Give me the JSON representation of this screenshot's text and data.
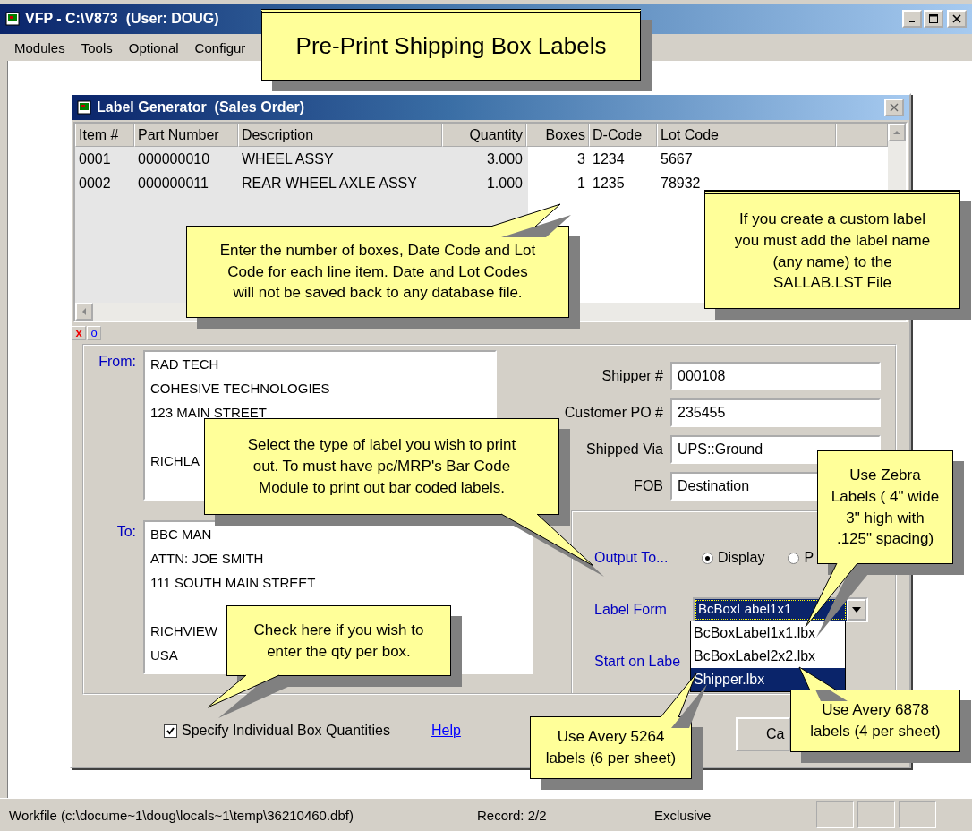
{
  "window": {
    "title": "VFP - C:\\V873  (User: DOUG)"
  },
  "menu": [
    {
      "label": "Modules"
    },
    {
      "label": "Tools"
    },
    {
      "label": "Optional"
    },
    {
      "label": "Configur"
    }
  ],
  "dialog": {
    "title": "Label Generator  (Sales Order)",
    "grid": {
      "columns": [
        "Item #",
        "Part Number",
        "Description",
        "Quantity",
        "Boxes",
        "D-Code",
        "Lot Code"
      ],
      "rows": [
        [
          "0001",
          "000000010",
          "WHEEL ASSY",
          "3.000",
          "3",
          "1234",
          "5667"
        ],
        [
          "0002",
          "000000011",
          "REAR WHEEL AXLE ASSY",
          "1.000",
          "1",
          "1235",
          "78932"
        ]
      ]
    },
    "toolbar": [
      "x",
      "o"
    ],
    "from": {
      "label": "From:",
      "blocks": [
        [
          "RAD TECH",
          "COHESIVE TECHNOLOGIES",
          "123 MAIN STREET"
        ],
        [
          "RICHLA"
        ]
      ]
    },
    "to": {
      "label": "To:",
      "blocks": [
        [
          "BBC MAN",
          "ATTN: JOE SMITH",
          "111 SOUTH MAIN STREET"
        ],
        [
          "RICHVIEW",
          "USA"
        ]
      ]
    },
    "fields": [
      {
        "label": "Shipper #",
        "value": "000108"
      },
      {
        "label": "Customer PO #",
        "value": "235455"
      },
      {
        "label": "Shipped Via",
        "value": "UPS::Ground"
      },
      {
        "label": "FOB",
        "value": "Destination"
      }
    ],
    "output": {
      "label": "Output To...",
      "options": [
        {
          "label": "Display",
          "selected": true
        },
        {
          "label": "P",
          "selected": false
        }
      ]
    },
    "label_form": {
      "label": "Label Form",
      "value": "BcBoxLabel1x1",
      "options": [
        {
          "label": "BcBoxLabel1x1.lbx",
          "selected": false
        },
        {
          "label": "BcBoxLabel2x2.lbx",
          "selected": false
        },
        {
          "label": "Shipper.lbx",
          "selected": true
        }
      ]
    },
    "start_label": {
      "label": "Start on Labe"
    },
    "specify": {
      "label": "Specify Individual Box Quantities",
      "checked": true
    },
    "help": "Help",
    "buttons": [
      "Ca"
    ]
  },
  "status_bar": [
    "Workfile (c:\\docume~1\\doug\\locals~1\\temp\\36210460.dbf)",
    "Record: 2/2",
    "Exclusive"
  ],
  "callouts": [
    "Pre-Print Shipping Box Labels",
    "Enter the number of boxes, Date Code and Lot\nCode for each line item.  Date and Lot Codes\nwill not be saved back to any database file.",
    "If you create a custom label\nyou must add the label name\n(any name) to the\nSALLAB.LST File",
    "Select the type of label you wish to print\nout.  To must have pc/MRP's Bar Code\nModule to print out bar coded labels.",
    "Use Zebra\nLabels ( 4\" wide\n3\" high with\n.125\" spacing)",
    "Check here if you wish to\nenter the qty per box.",
    "Use Avery 5264\nlabels (6 per sheet)",
    "Use Avery 6878\nlabels (4 per sheet)"
  ]
}
